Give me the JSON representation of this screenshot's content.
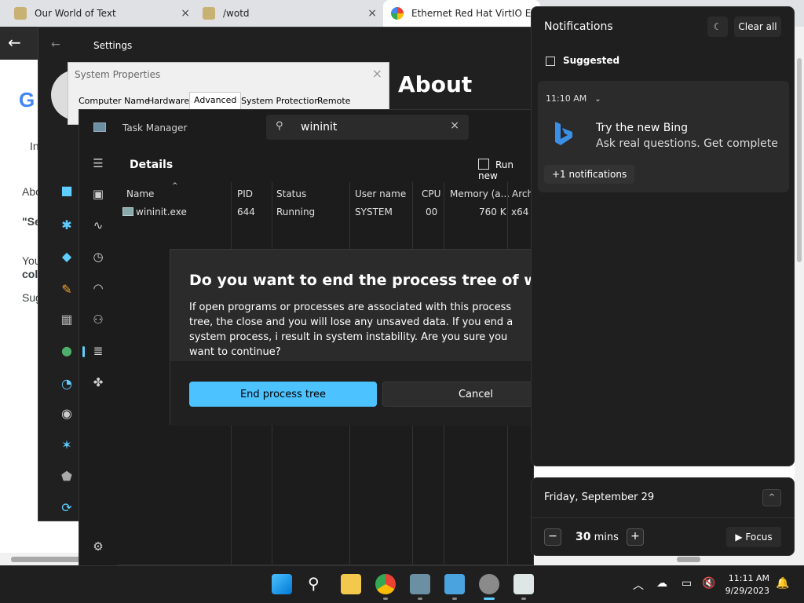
{
  "browser": {
    "tabs": [
      {
        "title": "Our World of Text",
        "close": "×"
      },
      {
        "title": "/wotd",
        "close": "×"
      },
      {
        "title": "Ethernet Red Hat VirtIO Ether"
      }
    ],
    "back_glyph": "←",
    "page": {
      "logo": "G",
      "side_texts": [
        "In",
        "Fi",
        "Abo",
        "\"Se",
        "You",
        "col",
        "Sug"
      ]
    }
  },
  "settings": {
    "title": "Settings",
    "back_glyph": "←",
    "heading": "About"
  },
  "system_properties": {
    "title": "System Properties",
    "close": "×",
    "tabs": [
      "Computer Name",
      "Hardware",
      "Advanced",
      "System Protection",
      "Remote"
    ],
    "active_tab": "Advanced"
  },
  "task_manager": {
    "title": "Task Manager",
    "search_value": "wininit",
    "search_clear": "×",
    "page_title": "Details",
    "run_new": "Run new",
    "columns": [
      "Name",
      "PID",
      "Status",
      "User name",
      "CPU",
      "Memory (a...",
      "Arch"
    ],
    "rows": [
      {
        "name": "wininit.exe",
        "pid": "644",
        "status": "Running",
        "user": "SYSTEM",
        "cpu": "00",
        "memory": "760 K",
        "arch": "x64"
      }
    ]
  },
  "dialog": {
    "title": "Do you want to end the process tree of wininit.e",
    "body": "If open programs or processes are associated with this process tree, the close and you will lose any unsaved data. If you end a system process, i result in system instability. Are you sure you want to continue?",
    "primary": "End process tree",
    "secondary": "Cancel"
  },
  "notifications": {
    "title": "Notifications",
    "clear_all": "Clear all",
    "suggested": "Suggested",
    "time": "11:10 AM",
    "item_title": "Try the new Bing",
    "item_body": "Ask real questions. Get complete",
    "more": "+1 notifications"
  },
  "calendar": {
    "date": "Friday, September 29",
    "collapse": "^",
    "minus": "−",
    "plus": "+",
    "minutes": "30",
    "minutes_unit": "mins",
    "focus": "Focus"
  },
  "taskbar": {
    "time": "11:11 AM",
    "date": "9/29/2023"
  },
  "colors": {
    "accent": "#4cc2ff",
    "dark_bg": "#202020"
  }
}
